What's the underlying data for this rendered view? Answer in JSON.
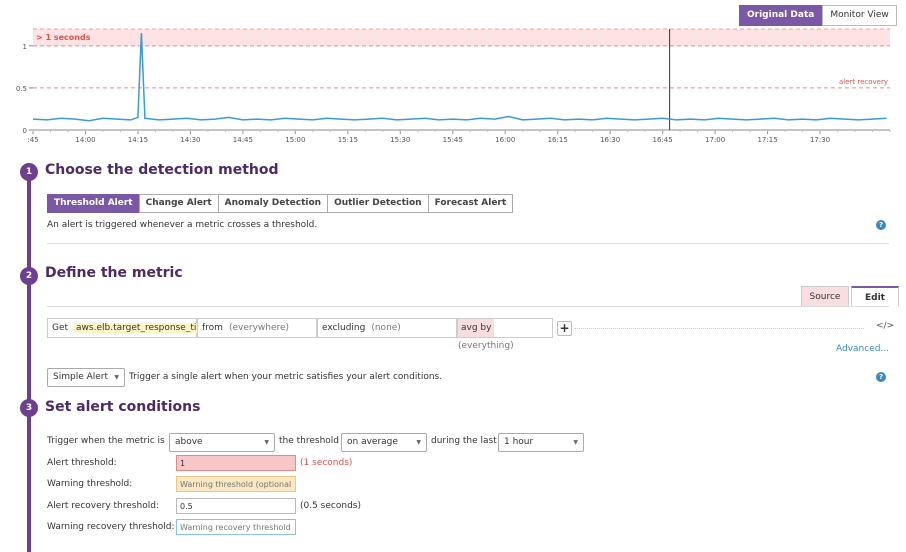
{
  "view_toggle": {
    "original": "Original Data",
    "monitor": "Monitor View"
  },
  "chart_data": {
    "type": "line",
    "xlim": [
      "13:45",
      "17:50"
    ],
    "ylim": [
      0,
      1.2
    ],
    "yticks": [
      "1",
      "0.5",
      "0"
    ],
    "xticks": [
      ":45",
      "14:00",
      "14:15",
      "14:30",
      "14:45",
      "15:00",
      "15:15",
      "15:30",
      "15:45",
      "16:00",
      "16:15",
      "16:30",
      "16:45",
      "17:00",
      "17:15",
      "17:30"
    ],
    "thresholds": [
      {
        "label": "> 1 seconds",
        "value": 1,
        "kind": "alert"
      },
      {
        "label": "alert recovery",
        "value": 0.5,
        "kind": "recovery"
      }
    ],
    "marker_time": "16:47",
    "series": [
      {
        "color": "#3a9ad9",
        "x": [
          "13:45",
          "13:49",
          "13:53",
          "13:57",
          "14:01",
          "14:05",
          "14:09",
          "14:13",
          "14:15",
          "14:16",
          "14:17",
          "14:21",
          "14:25",
          "14:29",
          "14:33",
          "14:37",
          "14:41",
          "14:45",
          "14:49",
          "14:53",
          "14:57",
          "15:01",
          "15:05",
          "15:09",
          "15:13",
          "15:17",
          "15:21",
          "15:25",
          "15:29",
          "15:33",
          "15:37",
          "15:41",
          "15:45",
          "15:49",
          "15:53",
          "15:57",
          "16:01",
          "16:05",
          "16:09",
          "16:13",
          "16:17",
          "16:21",
          "16:25",
          "16:29",
          "16:33",
          "16:37",
          "16:41",
          "16:45",
          "16:49",
          "16:53",
          "16:57",
          "17:01",
          "17:05",
          "17:09",
          "17:13",
          "17:17",
          "17:21",
          "17:25",
          "17:29",
          "17:33",
          "17:37",
          "17:41",
          "17:45",
          "17:49"
        ],
        "values": [
          0.13,
          0.12,
          0.14,
          0.13,
          0.11,
          0.14,
          0.13,
          0.12,
          0.15,
          1.15,
          0.14,
          0.12,
          0.13,
          0.14,
          0.12,
          0.13,
          0.15,
          0.12,
          0.13,
          0.12,
          0.14,
          0.13,
          0.12,
          0.14,
          0.13,
          0.12,
          0.13,
          0.14,
          0.12,
          0.13,
          0.14,
          0.12,
          0.13,
          0.12,
          0.14,
          0.13,
          0.16,
          0.12,
          0.13,
          0.14,
          0.12,
          0.13,
          0.12,
          0.14,
          0.13,
          0.12,
          0.13,
          0.14,
          0.12,
          0.13,
          0.12,
          0.14,
          0.13,
          0.12,
          0.13,
          0.14,
          0.12,
          0.13,
          0.12,
          0.14,
          0.13,
          0.12,
          0.13,
          0.14
        ]
      }
    ]
  },
  "step1": {
    "num": "1",
    "title": "Choose the detection method",
    "tabs": [
      "Threshold Alert",
      "Change Alert",
      "Anomaly Detection",
      "Outlier Detection",
      "Forecast Alert"
    ],
    "description": "An alert is triggered whenever a metric crosses a threshold."
  },
  "step2": {
    "num": "2",
    "title": "Define the metric",
    "source_tab": "Source",
    "edit_tab": "Edit",
    "query": {
      "get_label": "Get",
      "metric": "aws.elb.target_response_ti...",
      "from_label": "from",
      "from_value": "(everywhere)",
      "excluding_label": "excluding",
      "excluding_value": "(none)",
      "avg_by_label": "avg by",
      "avg_by_value": "(everything)"
    },
    "advanced": "Advanced...",
    "alert_type": "Simple Alert",
    "alert_type_desc": "Trigger a single alert when your metric satisfies your alert conditions."
  },
  "step3": {
    "num": "3",
    "title": "Set alert conditions",
    "trigger_prefix": "Trigger when the metric is",
    "comparison": "above",
    "threshold_text": "the threshold",
    "aggregation": "on average",
    "during_text": "during the last",
    "window": "1 hour",
    "alert_threshold_label": "Alert threshold:",
    "alert_threshold_value": "1",
    "alert_threshold_note": "(1 seconds)",
    "warning_threshold_label": "Warning threshold:",
    "warning_threshold_placeholder": "Warning threshold (optional)",
    "recovery_threshold_label": "Alert recovery threshold:",
    "recovery_threshold_value": "0.5",
    "recovery_threshold_note": "(0.5 seconds)",
    "warning_recovery_label": "Warning recovery threshold:",
    "warning_recovery_placeholder": "Warning recovery threshold"
  }
}
